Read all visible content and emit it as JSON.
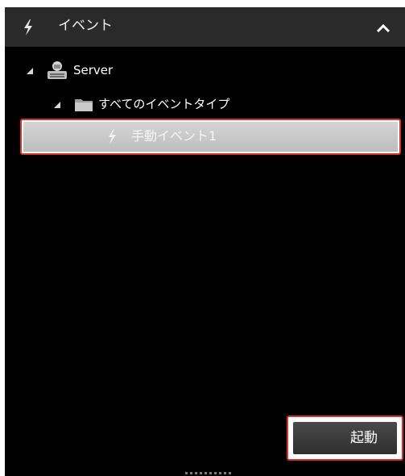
{
  "panel": {
    "title": "イベント",
    "title_icon": "lightning-icon",
    "collapse_icon": "chevron-up-icon"
  },
  "tree": {
    "server": {
      "label": "Server",
      "icon": "server-user-icon",
      "expanded": true
    },
    "folder": {
      "label": "すべてのイベントタイプ",
      "icon": "folder-icon",
      "expanded": true
    },
    "event": {
      "label": "手動イベント1",
      "icon": "lightning-icon",
      "selected": true
    }
  },
  "actions": {
    "start_label": "起動"
  },
  "colors": {
    "panel_bg": "#000000",
    "header_bg": "#2a2a2a",
    "highlight": "#d9322b",
    "selection_bg": "#c8c8c8"
  }
}
